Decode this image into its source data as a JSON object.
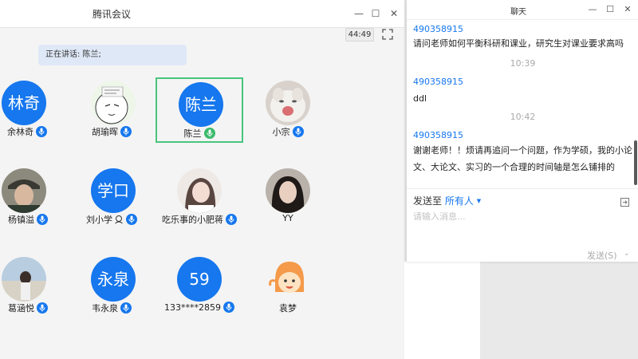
{
  "meeting": {
    "title": "腾讯会议",
    "timer": "44:49",
    "speaking_banner": "正在讲话: 陈兰;",
    "participants": [
      {
        "name": "余林奇",
        "avatar_text": "林奇",
        "avatar": "text",
        "mic": "blue-mic-icon"
      },
      {
        "name": "胡瑜晖",
        "avatar_text": "",
        "avatar": "cartoon-face-photo",
        "mic": "blue-mic-icon"
      },
      {
        "name": "陈兰",
        "avatar_text": "陈兰",
        "avatar": "text",
        "mic": "green-speaking-mic-icon",
        "active": true
      },
      {
        "name": "小宗",
        "avatar_text": "",
        "avatar": "cat-photo",
        "mic": "blue-mic-icon"
      },
      {
        "name": "杨镇溢",
        "avatar_text": "",
        "avatar": "man-cap-photo",
        "mic": "blue-mic-icon"
      },
      {
        "name": "刘小学",
        "avatar_text": "学口",
        "avatar": "text",
        "mic": "blue-mic-icon",
        "host": true
      },
      {
        "name": "吃乐事的小肥蒋",
        "avatar_text": "",
        "avatar": "girl-photo",
        "mic": "blue-mic-icon"
      },
      {
        "name": "YY",
        "avatar_text": "",
        "avatar": "girl-dark-photo",
        "mic": ""
      },
      {
        "name": "葛涵悦",
        "avatar_text": "",
        "avatar": "beach-photo",
        "mic": "blue-mic-icon"
      },
      {
        "name": "韦永泉",
        "avatar_text": "永泉",
        "avatar": "text",
        "mic": "blue-mic-icon"
      },
      {
        "name": "133****2859",
        "avatar_text": "59",
        "avatar": "text",
        "mic": "blue-mic-icon"
      },
      {
        "name": "袁梦",
        "avatar_text": "",
        "avatar": "cartoon-orange-photo",
        "mic": ""
      }
    ]
  },
  "chat": {
    "title": "聊天",
    "messages": [
      {
        "sender": "490358915",
        "text": "请问老师如何平衡科研和课业，研究生对课业要求高吗"
      },
      {
        "time": "10:39"
      },
      {
        "sender": "490358915",
        "text": "ddl"
      },
      {
        "time": "10:42"
      },
      {
        "sender": "490358915",
        "text": "谢谢老师！！烦请再追问一个问题，作为学硕，我的小论文、大论文、实习的一个合理的时间轴是怎么铺排的"
      }
    ],
    "send_to_label": "发送至",
    "send_to_target": "所有人",
    "input_placeholder": "请输入消息...",
    "send_button": "发送(S)"
  },
  "colors": {
    "accent": "#1677ee",
    "speaking_green": "#3cba6c",
    "active_border": "#49c57c"
  }
}
